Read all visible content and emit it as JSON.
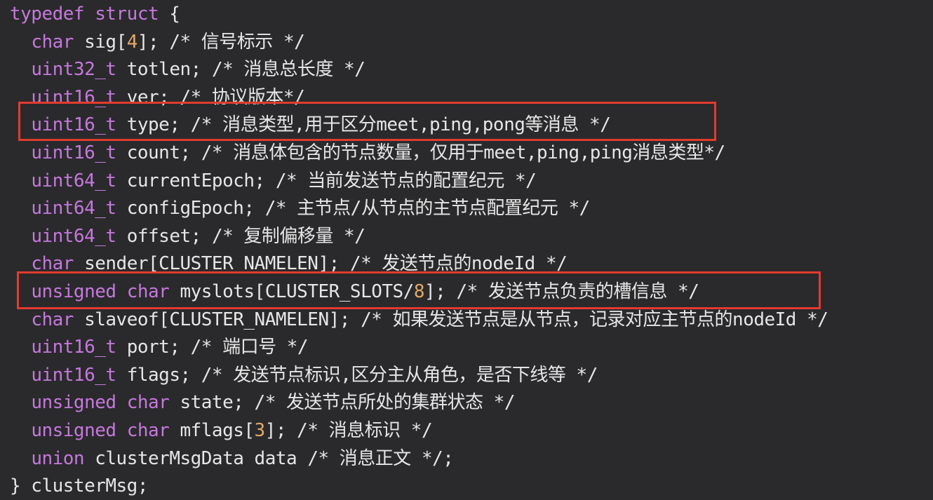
{
  "code": {
    "lines": [
      [
        {
          "t": "kw",
          "v": "typedef struct"
        },
        {
          "t": "plain",
          "v": " {"
        }
      ],
      [
        {
          "t": "plain",
          "v": "  "
        },
        {
          "t": "kw",
          "v": "char"
        },
        {
          "t": "plain",
          "v": " sig["
        },
        {
          "t": "num",
          "v": "4"
        },
        {
          "t": "plain",
          "v": "]; "
        },
        {
          "t": "comment",
          "v": "/* 信号标示 */"
        }
      ],
      [
        {
          "t": "plain",
          "v": "  "
        },
        {
          "t": "kw",
          "v": "uint32_t"
        },
        {
          "t": "plain",
          "v": " totlen; "
        },
        {
          "t": "comment",
          "v": "/* 消息总长度 */"
        }
      ],
      [
        {
          "t": "plain",
          "v": "  "
        },
        {
          "t": "kw",
          "v": "uint16_t"
        },
        {
          "t": "plain",
          "v": " ver; "
        },
        {
          "t": "comment",
          "v": "/* 协议版本*/"
        }
      ],
      [
        {
          "t": "plain",
          "v": "  "
        },
        {
          "t": "kw",
          "v": "uint16_t"
        },
        {
          "t": "plain",
          "v": " type; "
        },
        {
          "t": "comment",
          "v": "/* 消息类型,用于区分meet,ping,pong等消息 */"
        }
      ],
      [
        {
          "t": "plain",
          "v": "  "
        },
        {
          "t": "kw",
          "v": "uint16_t"
        },
        {
          "t": "plain",
          "v": " count; "
        },
        {
          "t": "comment",
          "v": "/* 消息体包含的节点数量，仅用于meet,ping,ping消息类型*/"
        }
      ],
      [
        {
          "t": "plain",
          "v": "  "
        },
        {
          "t": "kw",
          "v": "uint64_t"
        },
        {
          "t": "plain",
          "v": " currentEpoch; "
        },
        {
          "t": "comment",
          "v": "/* 当前发送节点的配置纪元 */"
        }
      ],
      [
        {
          "t": "plain",
          "v": "  "
        },
        {
          "t": "kw",
          "v": "uint64_t"
        },
        {
          "t": "plain",
          "v": " configEpoch; "
        },
        {
          "t": "comment",
          "v": "/* 主节点/从节点的主节点配置纪元 */"
        }
      ],
      [
        {
          "t": "plain",
          "v": "  "
        },
        {
          "t": "kw",
          "v": "uint64_t"
        },
        {
          "t": "plain",
          "v": " offset; "
        },
        {
          "t": "comment",
          "v": "/* 复制偏移量 */"
        }
      ],
      [
        {
          "t": "plain",
          "v": "  "
        },
        {
          "t": "kw",
          "v": "char"
        },
        {
          "t": "plain",
          "v": " sender[CLUSTER_NAMELEN]; "
        },
        {
          "t": "comment",
          "v": "/* 发送节点的nodeId */"
        }
      ],
      [
        {
          "t": "plain",
          "v": "  "
        },
        {
          "t": "kw",
          "v": "unsigned char"
        },
        {
          "t": "plain",
          "v": " myslots[CLUSTER_SLOTS/"
        },
        {
          "t": "num",
          "v": "8"
        },
        {
          "t": "plain",
          "v": "]; "
        },
        {
          "t": "comment",
          "v": "/* 发送节点负责的槽信息 */"
        }
      ],
      [
        {
          "t": "plain",
          "v": "  "
        },
        {
          "t": "kw",
          "v": "char"
        },
        {
          "t": "plain",
          "v": " slaveof[CLUSTER_NAMELEN]; "
        },
        {
          "t": "comment",
          "v": "/* 如果发送节点是从节点，记录对应主节点的nodeId */"
        }
      ],
      [
        {
          "t": "plain",
          "v": "  "
        },
        {
          "t": "kw",
          "v": "uint16_t"
        },
        {
          "t": "plain",
          "v": " port; "
        },
        {
          "t": "comment",
          "v": "/* 端口号 */"
        }
      ],
      [
        {
          "t": "plain",
          "v": "  "
        },
        {
          "t": "kw",
          "v": "uint16_t"
        },
        {
          "t": "plain",
          "v": " flags; "
        },
        {
          "t": "comment",
          "v": "/* 发送节点标识,区分主从角色，是否下线等 */"
        }
      ],
      [
        {
          "t": "plain",
          "v": "  "
        },
        {
          "t": "kw",
          "v": "unsigned char"
        },
        {
          "t": "plain",
          "v": " state; "
        },
        {
          "t": "comment",
          "v": "/* 发送节点所处的集群状态 */"
        }
      ],
      [
        {
          "t": "plain",
          "v": "  "
        },
        {
          "t": "kw",
          "v": "unsigned char"
        },
        {
          "t": "plain",
          "v": " mflags["
        },
        {
          "t": "num",
          "v": "3"
        },
        {
          "t": "plain",
          "v": "]; "
        },
        {
          "t": "comment",
          "v": "/* 消息标识 */"
        }
      ],
      [
        {
          "t": "plain",
          "v": "  "
        },
        {
          "t": "kw",
          "v": "union"
        },
        {
          "t": "plain",
          "v": " clusterMsgData data "
        },
        {
          "t": "comment",
          "v": "/* 消息正文 */;"
        }
      ],
      [
        {
          "t": "plain",
          "v": "} clusterMsg;"
        }
      ]
    ]
  },
  "colors": {
    "background": "#2a2a2c",
    "keyword": "#c678dd",
    "number": "#e5a766",
    "text": "#e6e6e6",
    "highlight": "#e23b2f"
  }
}
